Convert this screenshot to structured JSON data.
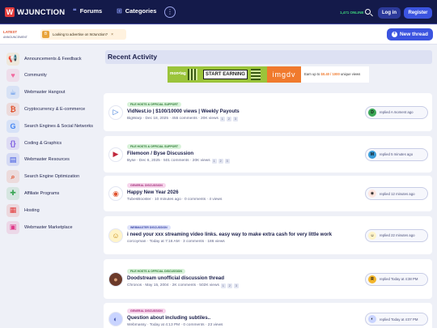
{
  "header": {
    "logo_mark": "W",
    "logo_text": "WJUNCTION",
    "nav": [
      {
        "label": "Forums",
        "icon": "forums-icon"
      },
      {
        "label": "Categories",
        "icon": "categories-icon"
      }
    ],
    "more_glyph": "⋮",
    "online_label": "1,471 ONLINE",
    "login_label": "Log in",
    "register_label": "Register"
  },
  "subbar": {
    "latest_label": "LATEST",
    "latest_sub": "ANNOUNCEMENT",
    "ticker_badge": "B",
    "ticker_text": "Looking to advertise on WJunction?",
    "ticker_close": "×",
    "new_thread_label": "New thread"
  },
  "sidebar": {
    "items": [
      {
        "label": "Announcements & Feedback",
        "icon": "megaphone-icon",
        "color": "#f2b52b"
      },
      {
        "label": "Community",
        "icon": "community-icon",
        "color": "#f26aa0"
      },
      {
        "label": "Webmaster Hangout",
        "icon": "hangout-icon",
        "color": "#4a8ae8"
      },
      {
        "label": "Cryptocurrency & E-commerce",
        "icon": "crypto-icon",
        "color": "#e0522d"
      },
      {
        "label": "Search Engines & Social Networks",
        "icon": "google-icon",
        "color": "#4285f4"
      },
      {
        "label": "Coding & Graphics",
        "icon": "coding-icon",
        "color": "#7a5ae0"
      },
      {
        "label": "Webmaster Resources",
        "icon": "resources-icon",
        "color": "#3b54e0"
      },
      {
        "label": "Search Engine Optimization",
        "icon": "seo-icon",
        "color": "#e0522d"
      },
      {
        "label": "Affiliate Programs",
        "icon": "affiliate-icon",
        "color": "#3aa655"
      },
      {
        "label": "Hosting",
        "icon": "hosting-icon",
        "color": "#e33b3b"
      },
      {
        "label": "Webmaster Marketplace",
        "icon": "marketplace-icon",
        "color": "#e03b8a"
      }
    ]
  },
  "main": {
    "title": "Recent Activity",
    "ad": {
      "brand": "mon•tag",
      "cta": "START EARNING",
      "logo2": "imgdv",
      "tag_prefix": "Earn up to ",
      "tag_amount": "$0.40 / 1000",
      "tag_suffix": " unique views"
    },
    "threads": [
      {
        "prefix": "FILE HOSTS & OFFICIAL SUPPORT",
        "prefix_bg": "#d8f2d9",
        "prefix_fg": "#2f7a36",
        "title": "VidNest.io | $100/10000 views | Weekly Payouts",
        "meta": "BigWarp · Dec 18, 2025 · 455 comments · 20K views",
        "pages": [
          "1",
          "2",
          "3"
        ],
        "avatar_glyph": "▷",
        "avatar_bg": "#ffffff",
        "avatar_fg": "#2b6fd6",
        "reply_text": "replied A moment ago",
        "reply_initial": "D",
        "reply_color": "#3aa655"
      },
      {
        "prefix": "FILE HOSTS & OFFICIAL SUPPORT",
        "prefix_bg": "#d8f2d9",
        "prefix_fg": "#2f7a36",
        "title": "Filemoon / Byse Discussion",
        "meta": "Byse · Dec 6, 2025 · 501 comments · 20K views",
        "pages": [
          "1",
          "2",
          "3"
        ],
        "avatar_glyph": "▶",
        "avatar_bg": "#ffffff",
        "avatar_fg": "#c0283c",
        "reply_text": "replied 5 minutes ago",
        "reply_initial": "M",
        "reply_color": "#3a9bd6"
      },
      {
        "prefix": "GENERAL DISCUSSION",
        "prefix_bg": "#f7d6ec",
        "prefix_fg": "#a3307a",
        "title": "Happy New Year 2026",
        "meta": "TubesBooster · 10 minutes ago · 0 comments · 4 views",
        "pages": [],
        "avatar_glyph": "◉",
        "avatar_bg": "#ffffff",
        "avatar_fg": "#e0522d",
        "reply_text": "replied 12 minutes ago",
        "reply_initial": "◉",
        "reply_color": "#ffe6e0"
      },
      {
        "prefix": "WEBMASTER DISCUSSION",
        "prefix_bg": "#dfe3fa",
        "prefix_fg": "#3b47a8",
        "title": "i need your xxx streaming video links. easy way to make extra cash for very little work",
        "meta": "corcoyman · Today at 7:16 AM · 3 comments · 186 views",
        "pages": [],
        "avatar_glyph": "☺",
        "avatar_bg": "#fff4c9",
        "avatar_fg": "#c48a12",
        "reply_text": "replied 22 minutes ago",
        "reply_initial": "☺",
        "reply_color": "#fff4c9"
      },
      {
        "prefix": "FILE HOSTS & OFFICIAL DISCUSSION",
        "prefix_bg": "#d8f2d9",
        "prefix_fg": "#2f7a36",
        "title": "Doodstream unofficial discussion thread",
        "meta": "Chronos · May 15, 2004 · 2K comments · 502K views",
        "pages": [
          "1",
          "2",
          "3"
        ],
        "avatar_glyph": "●",
        "avatar_bg": "#6b3a2a",
        "avatar_fg": "#d9a07a",
        "reply_text": "replied Today at 4:38 PM",
        "reply_initial": "R",
        "reply_color": "#f2b52b"
      },
      {
        "prefix": "GENERAL DISCUSSION",
        "prefix_bg": "#f7d6ec",
        "prefix_fg": "#a3307a",
        "title": "Question about including subtiles..",
        "meta": "Webmassy · Today at 4:13 PM · 0 comments · 23 views",
        "pages": [],
        "avatar_glyph": "◐",
        "avatar_bg": "#c9d4ff",
        "avatar_fg": "#4a5ab0",
        "reply_text": "replied Today at 4:07 PM",
        "reply_initial": "◐",
        "reply_color": "#c9d4ff"
      }
    ]
  }
}
